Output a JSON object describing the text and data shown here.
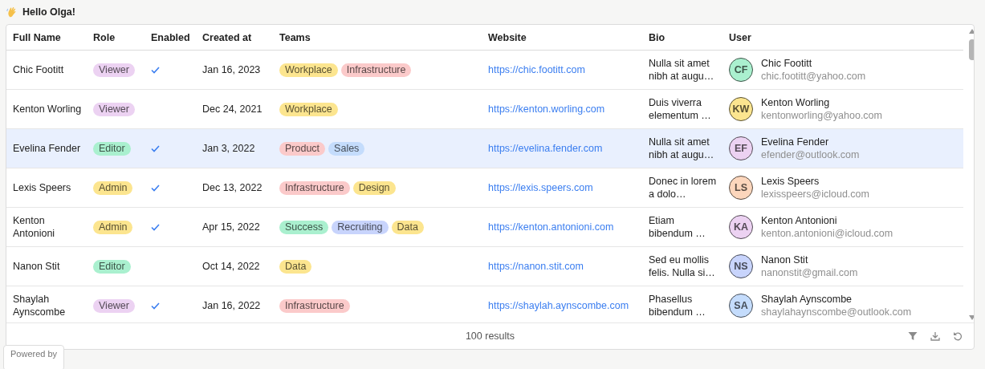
{
  "greeting": "Hello Olga!",
  "table": {
    "columns": [
      "Full Name",
      "Role",
      "Enabled",
      "Created at",
      "Teams",
      "Website",
      "Bio",
      "User"
    ],
    "rows": [
      {
        "selected": false,
        "full_name": "Chic Footitt",
        "role": {
          "label": "Viewer",
          "color": "#ecd2f2"
        },
        "enabled": true,
        "created_at": "Jan 16, 2023",
        "teams": [
          {
            "label": "Workplace",
            "color": "#fce58f"
          },
          {
            "label": "Infrastructure",
            "color": "#fbcaca"
          }
        ],
        "website": "https://chic.footitt.com",
        "bio": "Nulla sit amet nibh at augu…",
        "user": {
          "initials": "CF",
          "color": "#aaf0cf",
          "name": "Chic Footitt",
          "email": "chic.footitt@yahoo.com"
        }
      },
      {
        "selected": false,
        "full_name": "Kenton Worling",
        "role": {
          "label": "Viewer",
          "color": "#ecd2f2"
        },
        "enabled": false,
        "created_at": "Dec 24, 2021",
        "teams": [
          {
            "label": "Workplace",
            "color": "#fce58f"
          }
        ],
        "website": "https://kenton.worling.com",
        "bio": "Duis viverra elementum …",
        "user": {
          "initials": "KW",
          "color": "#fce58f",
          "name": "Kenton Worling",
          "email": "kentonworling@yahoo.com"
        }
      },
      {
        "selected": true,
        "full_name": "Evelina Fender",
        "role": {
          "label": "Editor",
          "color": "#aaf0cf"
        },
        "enabled": true,
        "created_at": "Jan 3, 2022",
        "teams": [
          {
            "label": "Product",
            "color": "#fbcaca"
          },
          {
            "label": "Sales",
            "color": "#c4dcfc"
          }
        ],
        "website": "https://evelina.fender.com",
        "bio": "Nulla sit amet nibh at augu…",
        "user": {
          "initials": "EF",
          "color": "#ecd2f2",
          "name": "Evelina Fender",
          "email": "efender@outlook.com"
        }
      },
      {
        "selected": false,
        "full_name": "Lexis Speers",
        "role": {
          "label": "Admin",
          "color": "#fce58f"
        },
        "enabled": true,
        "created_at": "Dec 13, 2022",
        "teams": [
          {
            "label": "Infrastructure",
            "color": "#fbcaca"
          },
          {
            "label": "Design",
            "color": "#fce58f"
          }
        ],
        "website": "https://lexis.speers.com",
        "bio": "Donec in lorem a dolo…",
        "user": {
          "initials": "LS",
          "color": "#fcd6bc",
          "name": "Lexis Speers",
          "email": "lexisspeers@icloud.com"
        }
      },
      {
        "selected": false,
        "full_name": "Kenton Antonioni",
        "role": {
          "label": "Admin",
          "color": "#fce58f"
        },
        "enabled": true,
        "created_at": "Apr 15, 2022",
        "teams": [
          {
            "label": "Success",
            "color": "#aaf0cf"
          },
          {
            "label": "Recruiting",
            "color": "#c8d4fc"
          },
          {
            "label": "Data",
            "color": "#fce58f"
          }
        ],
        "website": "https://kenton.antonioni.com",
        "bio": "Etiam bibendum …",
        "user": {
          "initials": "KA",
          "color": "#ecd2f2",
          "name": "Kenton Antonioni",
          "email": "kenton.antonioni@icloud.com"
        }
      },
      {
        "selected": false,
        "full_name": "Nanon Stit",
        "role": {
          "label": "Editor",
          "color": "#aaf0cf"
        },
        "enabled": false,
        "created_at": "Oct 14, 2022",
        "teams": [
          {
            "label": "Data",
            "color": "#fce58f"
          }
        ],
        "website": "https://nanon.stit.com",
        "bio": "Sed eu mollis felis. Nulla si…",
        "user": {
          "initials": "NS",
          "color": "#c8d4fc",
          "name": "Nanon Stit",
          "email": "nanonstit@gmail.com"
        }
      },
      {
        "selected": false,
        "full_name": "Shaylah Aynscombe",
        "role": {
          "label": "Viewer",
          "color": "#ecd2f2"
        },
        "enabled": true,
        "created_at": "Jan 16, 2022",
        "teams": [
          {
            "label": "Infrastructure",
            "color": "#fbcaca"
          }
        ],
        "website": "https://shaylah.aynscombe.com",
        "bio": "Phasellus bibendum …",
        "user": {
          "initials": "SA",
          "color": "#c4dcfc",
          "name": "Shaylah Aynscombe",
          "email": "shaylahaynscombe@outlook.com"
        }
      }
    ],
    "result_count": "100 results"
  },
  "badge": {
    "text": "Powered by"
  }
}
